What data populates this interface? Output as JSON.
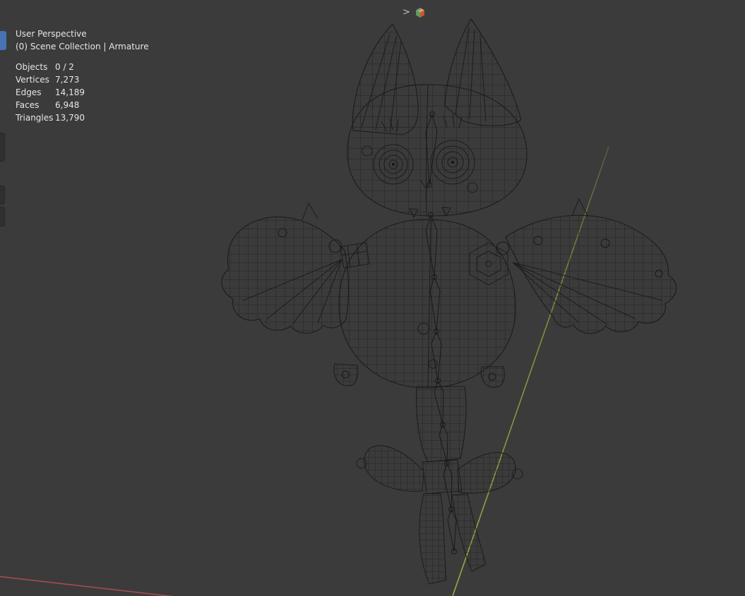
{
  "viewport": {
    "perspective_label": "User Perspective",
    "collection_label": "(0) Scene Collection | Armature"
  },
  "stats": {
    "rows": [
      {
        "label": "Objects",
        "value": "0 / 2"
      },
      {
        "label": "Vertices",
        "value": "7,273"
      },
      {
        "label": "Edges",
        "value": "14,189"
      },
      {
        "label": "Faces",
        "value": "6,948"
      },
      {
        "label": "Triangles",
        "value": "13,790"
      }
    ]
  },
  "header": {
    "collapse_chevron": ">",
    "editor_icon": "scene-cube-icon"
  },
  "colors": {
    "background": "#3b3b3b",
    "wireframe": "#1c1c1c",
    "axis_green": "#7f9a3d",
    "axis_red": "#a94d52",
    "active_tab_blue": "#4772b3",
    "text": "#e6e6e6"
  }
}
